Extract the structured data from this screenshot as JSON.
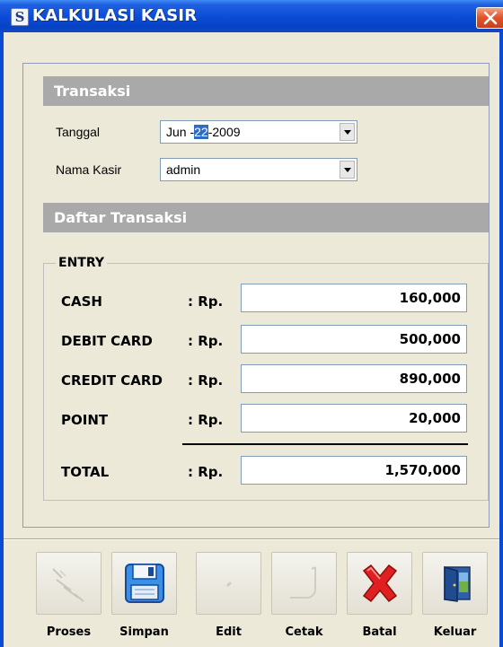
{
  "window": {
    "title": "KALKULASI KASIR",
    "icon": "kasir-app-icon",
    "icon_glyph": "S",
    "close_icon": "close-icon"
  },
  "transaksi": {
    "header": "Transaksi",
    "tanggal_label": "Tanggal",
    "tanggal_before": "Jun -",
    "tanggal_selected": "22",
    "tanggal_after": "-2009",
    "kasir_label": "Nama Kasir",
    "kasir_value": "admin"
  },
  "daftar": {
    "header": "Daftar Transaksi"
  },
  "entry": {
    "legend": "ENTRY",
    "currency": ": Rp.",
    "rows": [
      {
        "label": "CASH",
        "amount": "160,000"
      },
      {
        "label": "DEBIT CARD",
        "amount": "500,000"
      },
      {
        "label": "CREDIT CARD",
        "amount": "890,000"
      },
      {
        "label": "POINT",
        "amount": "20,000"
      }
    ],
    "total_label": "TOTAL",
    "total_amount": "1,570,000"
  },
  "toolbar": {
    "buttons": [
      {
        "label": "Proses",
        "icon": "process-icon",
        "enabled": false
      },
      {
        "label": "Simpan",
        "icon": "floppy-disk-icon",
        "enabled": true
      },
      {
        "label": "Edit",
        "icon": "edit-icon",
        "enabled": false
      },
      {
        "label": "Cetak",
        "icon": "print-icon",
        "enabled": false
      },
      {
        "label": "Batal",
        "icon": "cancel-x-icon",
        "enabled": true
      },
      {
        "label": "Keluar",
        "icon": "exit-door-icon",
        "enabled": true
      }
    ]
  },
  "colors": {
    "titlebar": "#0A4BD6",
    "section_header": "#A9A9A9",
    "selection": "#316AC5",
    "cancel_red": "#E02020"
  }
}
